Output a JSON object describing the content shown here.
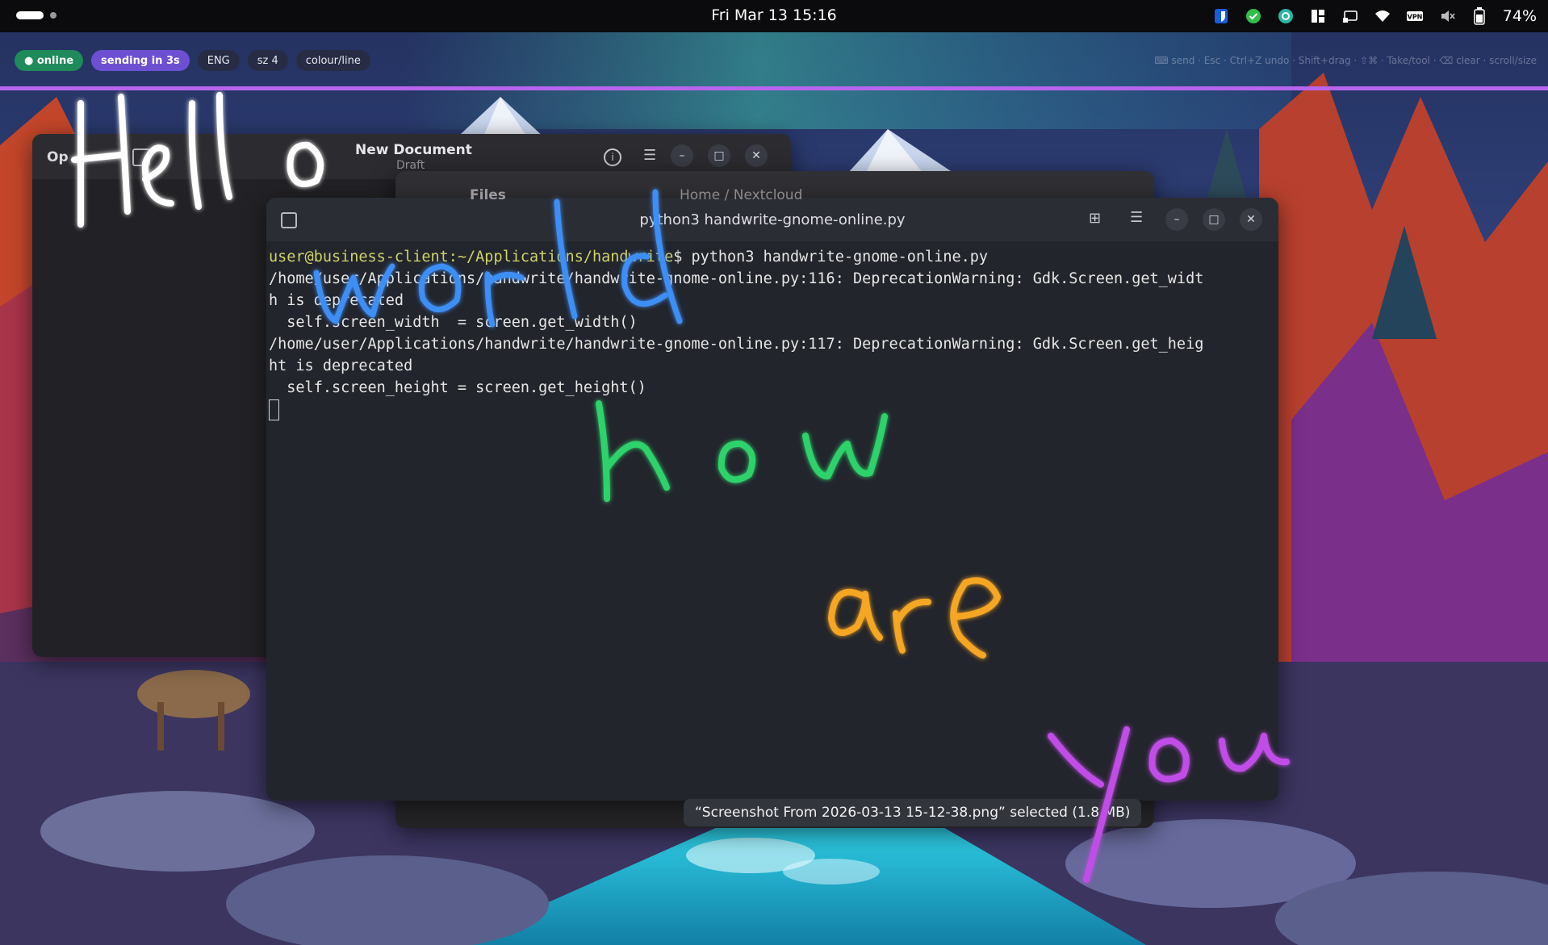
{
  "topbar": {
    "clock": "Fri Mar 13  15:16",
    "battery": "74%",
    "tray_icons": [
      "bitwarden-icon",
      "check-icon",
      "sync-icon",
      "layout-icon",
      "cast-icon",
      "wifi-icon",
      "vpn-icon",
      "mute-icon",
      "battery-icon"
    ]
  },
  "handwrite": {
    "status_online": "● online",
    "status_sending": "sending in 3s",
    "lang": "ENG",
    "size": "sz 4",
    "mode": "colour/line",
    "hint": "⌨ send · Esc · Ctrl+Z undo · Shift+drag · ⇧⌘ · Take/tool · ⌫ clear · scroll/size",
    "line_color": "#b864ee",
    "ink_words": [
      {
        "text": "Hello",
        "color": "#ffffff"
      },
      {
        "text": "world",
        "color": "#3d8ef5"
      },
      {
        "text": "how",
        "color": "#2ed26a"
      },
      {
        "text": "are",
        "color": "#f5a623"
      },
      {
        "text": "you",
        "color": "#c14ee8"
      }
    ]
  },
  "text_editor": {
    "title": "New Document",
    "subtitle": "Draft",
    "side_label": "Op"
  },
  "files": {
    "title": "Files",
    "path": "Home  /  Nextcloud"
  },
  "terminal": {
    "title": "python3 handwrite-gnome-online.py",
    "prompt_user": "user@business-client:~/Applications/handwrite",
    "prompt_cmd": "$ python3 handwrite-gnome-online.py",
    "lines": [
      "/home/user/Applications/handwrite/handwrite-gnome-online.py:116: DeprecationWarning: Gdk.Screen.get_widt",
      "h is deprecated",
      "  self.screen_width  = screen.get_width()",
      "/home/user/Applications/handwrite/handwrite-gnome-online.py:117: DeprecationWarning: Gdk.Screen.get_heig",
      "ht is deprecated",
      "  self.screen_height = screen.get_height()"
    ]
  },
  "toast": {
    "text": "“Screenshot From 2026-03-13 15-12-38.png” selected  (1.8 MB)"
  }
}
